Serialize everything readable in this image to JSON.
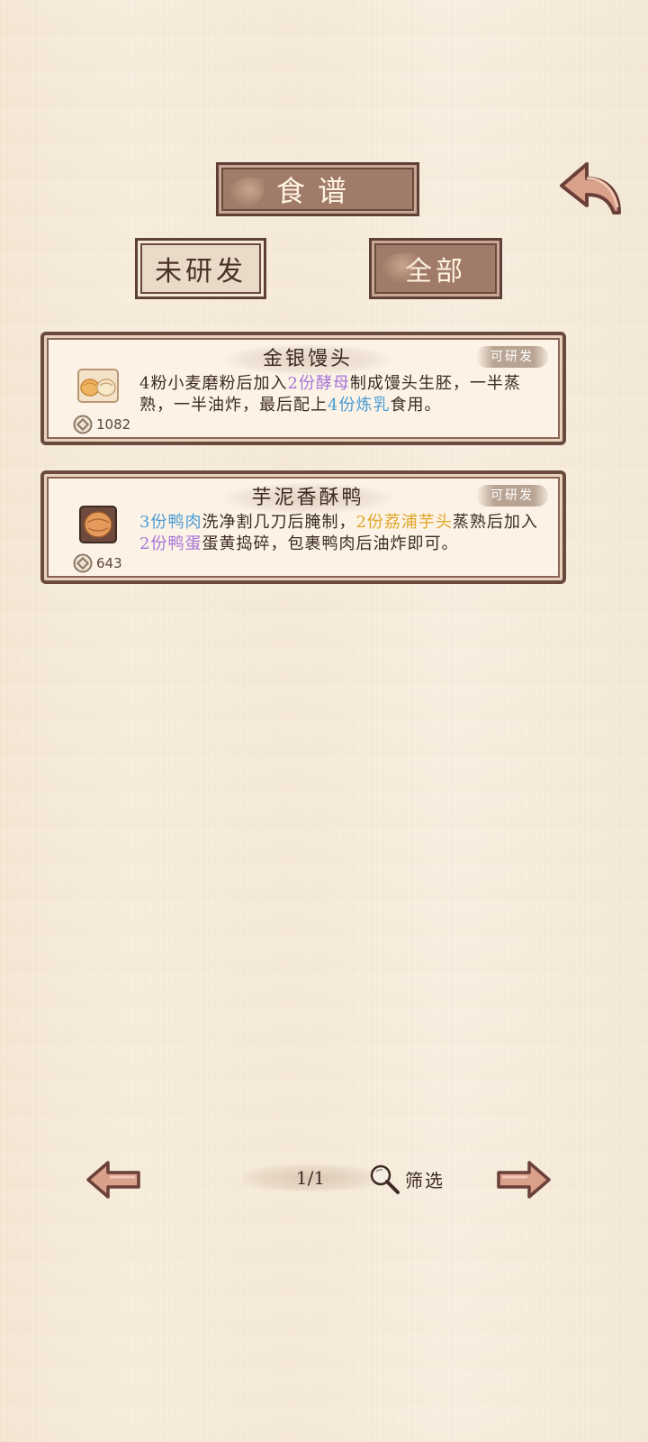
{
  "header": {
    "title": "食谱"
  },
  "tabs": [
    {
      "label": "未研发"
    },
    {
      "label": "全部"
    }
  ],
  "recipes": [
    {
      "name": "金银馒头",
      "status": "可研发",
      "price": "1082",
      "icon": "steamed-bun-icon",
      "desc_parts": [
        "4粉小麦磨粉后加入",
        "2份酵母",
        "制成馒头生胚，一半蒸熟，一半油炸，最后配上",
        "4份炼乳",
        "食用。"
      ]
    },
    {
      "name": "芋泥香酥鸭",
      "status": "可研发",
      "price": "643",
      "icon": "crispy-duck-icon",
      "desc_parts": [
        "3份鸭肉",
        "洗净割几刀后腌制，",
        "2份荔浦芋头",
        "蒸熟后加入",
        "2份鸭蛋",
        "蛋黄捣碎，包裹鸭肉后油炸即可。"
      ]
    }
  ],
  "pagination": {
    "page": "1/1",
    "filter_label": "筛选"
  },
  "colors": {
    "plaque": "#a07b69",
    "border": "#6b4a3e",
    "card_bg": "#fcf3e6",
    "highlight_purple": "#a475d6",
    "highlight_blue": "#4a9bd4",
    "highlight_gold": "#e0a628"
  }
}
